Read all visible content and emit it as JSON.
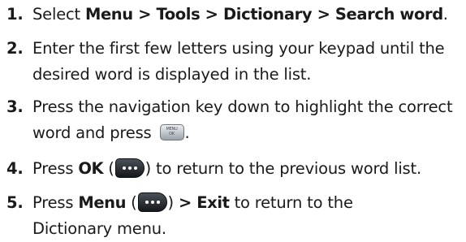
{
  "steps": [
    {
      "number": "1.",
      "lines": [
        {
          "select": "Select ",
          "path": "Menu > Tools > Dictionary > Search word",
          "end": "."
        }
      ]
    },
    {
      "number": "2.",
      "lines": [
        "Enter the first few letters using your keypad until the",
        "desired word is displayed in the list."
      ]
    },
    {
      "number": "3.",
      "lines": [
        "Press the navigation key down to highlight the correct",
        {
          "before": "word and press ",
          "after": "."
        }
      ],
      "key_label_line1": "MENU",
      "key_label_line2": "OK"
    },
    {
      "number": "4.",
      "press": "Press ",
      "bold": "OK",
      "open": " (",
      "close": ") to return to the previous word list."
    },
    {
      "number": "5.",
      "press": "Press ",
      "bold": "Menu",
      "open": " (",
      "close_arrow": ") ",
      "bold2": "> Exit",
      "rest": " to return to the",
      "line2": "Dictionary menu."
    }
  ],
  "icons": {
    "menu_ok_key": "menu-ok-key-icon",
    "soft_key": "soft-key-icon"
  }
}
